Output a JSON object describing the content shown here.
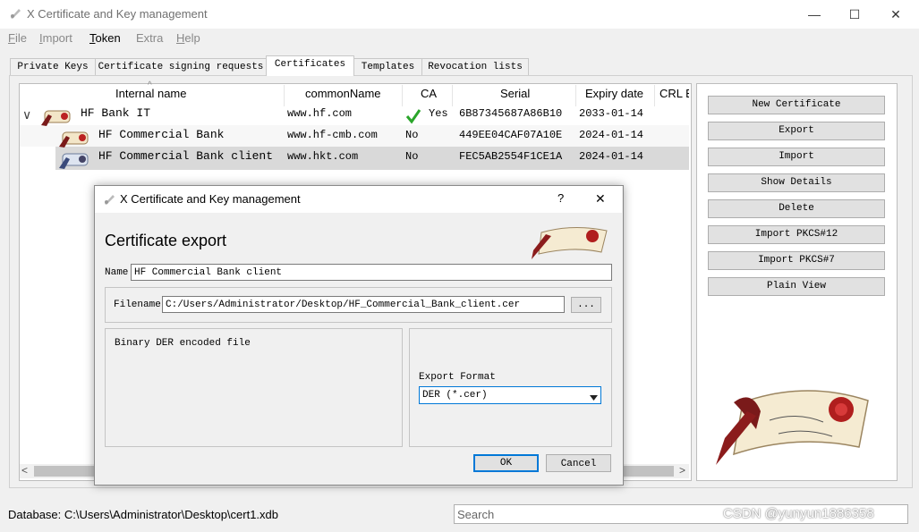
{
  "window": {
    "title": "X Certificate and Key management",
    "controls": {
      "minimize": "—",
      "maximize": "☐",
      "close": "✕"
    }
  },
  "menu": {
    "items": [
      {
        "label": "File",
        "mnemonic": "F",
        "rest": "ile"
      },
      {
        "label": "Import",
        "mnemonic": "I",
        "rest": "mport"
      },
      {
        "label": "Token",
        "mnemonic": "T",
        "rest": "oken"
      },
      {
        "label": "Extra",
        "mnemonic": "",
        "rest": "Extra"
      },
      {
        "label": "Help",
        "mnemonic": "H",
        "rest": "elp"
      }
    ]
  },
  "tabs": [
    {
      "label": "Private Keys"
    },
    {
      "label": "Certificate signing requests"
    },
    {
      "label": "Certificates"
    },
    {
      "label": "Templates"
    },
    {
      "label": "Revocation lists"
    }
  ],
  "tree": {
    "columns": [
      "Internal name",
      "commonName",
      "CA",
      "Serial",
      "Expiry date",
      "CRL E"
    ],
    "rows": [
      {
        "name": "HF Bank IT",
        "cn": "www.hf.com",
        "ca": "Yes",
        "serial": "6B87345687A86B10",
        "expiry": "2033-01-14"
      },
      {
        "name": "HF Commercial Bank",
        "cn": "www.hf-cmb.com",
        "ca": "No",
        "serial": "449EE04CAF07A10E",
        "expiry": "2024-01-14"
      },
      {
        "name": "HF Commercial Bank client",
        "cn": "www.hkt.com",
        "ca": "No",
        "serial": "FEC5AB2554F1CE1A",
        "expiry": "2024-01-14"
      }
    ],
    "expand_glyph": "∨",
    "sort_glyph": "^",
    "scroll_left": "<",
    "scroll_right": ">"
  },
  "side_buttons": {
    "new_certificate": "New Certificate",
    "export": "Export",
    "import": "Import",
    "show_details": "Show Details",
    "delete": "Delete",
    "import_pkcs12": "Import PKCS#12",
    "import_pkcs7": "Import PKCS#7",
    "plain_view": "Plain View"
  },
  "status": {
    "database": "Database: C:\\Users\\Administrator\\Desktop\\cert1.xdb",
    "search_placeholder": "Search",
    "watermark": "CSDN @yunyun1886358"
  },
  "dialog": {
    "title": "X Certificate and Key management",
    "help": "?",
    "close": "✕",
    "heading": "Certificate export",
    "name_label": "Name",
    "name_value": "HF Commercial Bank client",
    "filename_label": "Filename",
    "filename_value": "C:/Users/Administrator/Desktop/HF_Commercial_Bank_client.cer",
    "browse": "...",
    "description": "Binary DER encoded file",
    "format_label": "Export Format",
    "format_value": "DER (*.cer)",
    "ok": "OK",
    "cancel": "Cancel"
  },
  "colors": {
    "accent": "#0078d7",
    "selected_row": "#d9d9d9",
    "check_green": "#2aa52a"
  }
}
